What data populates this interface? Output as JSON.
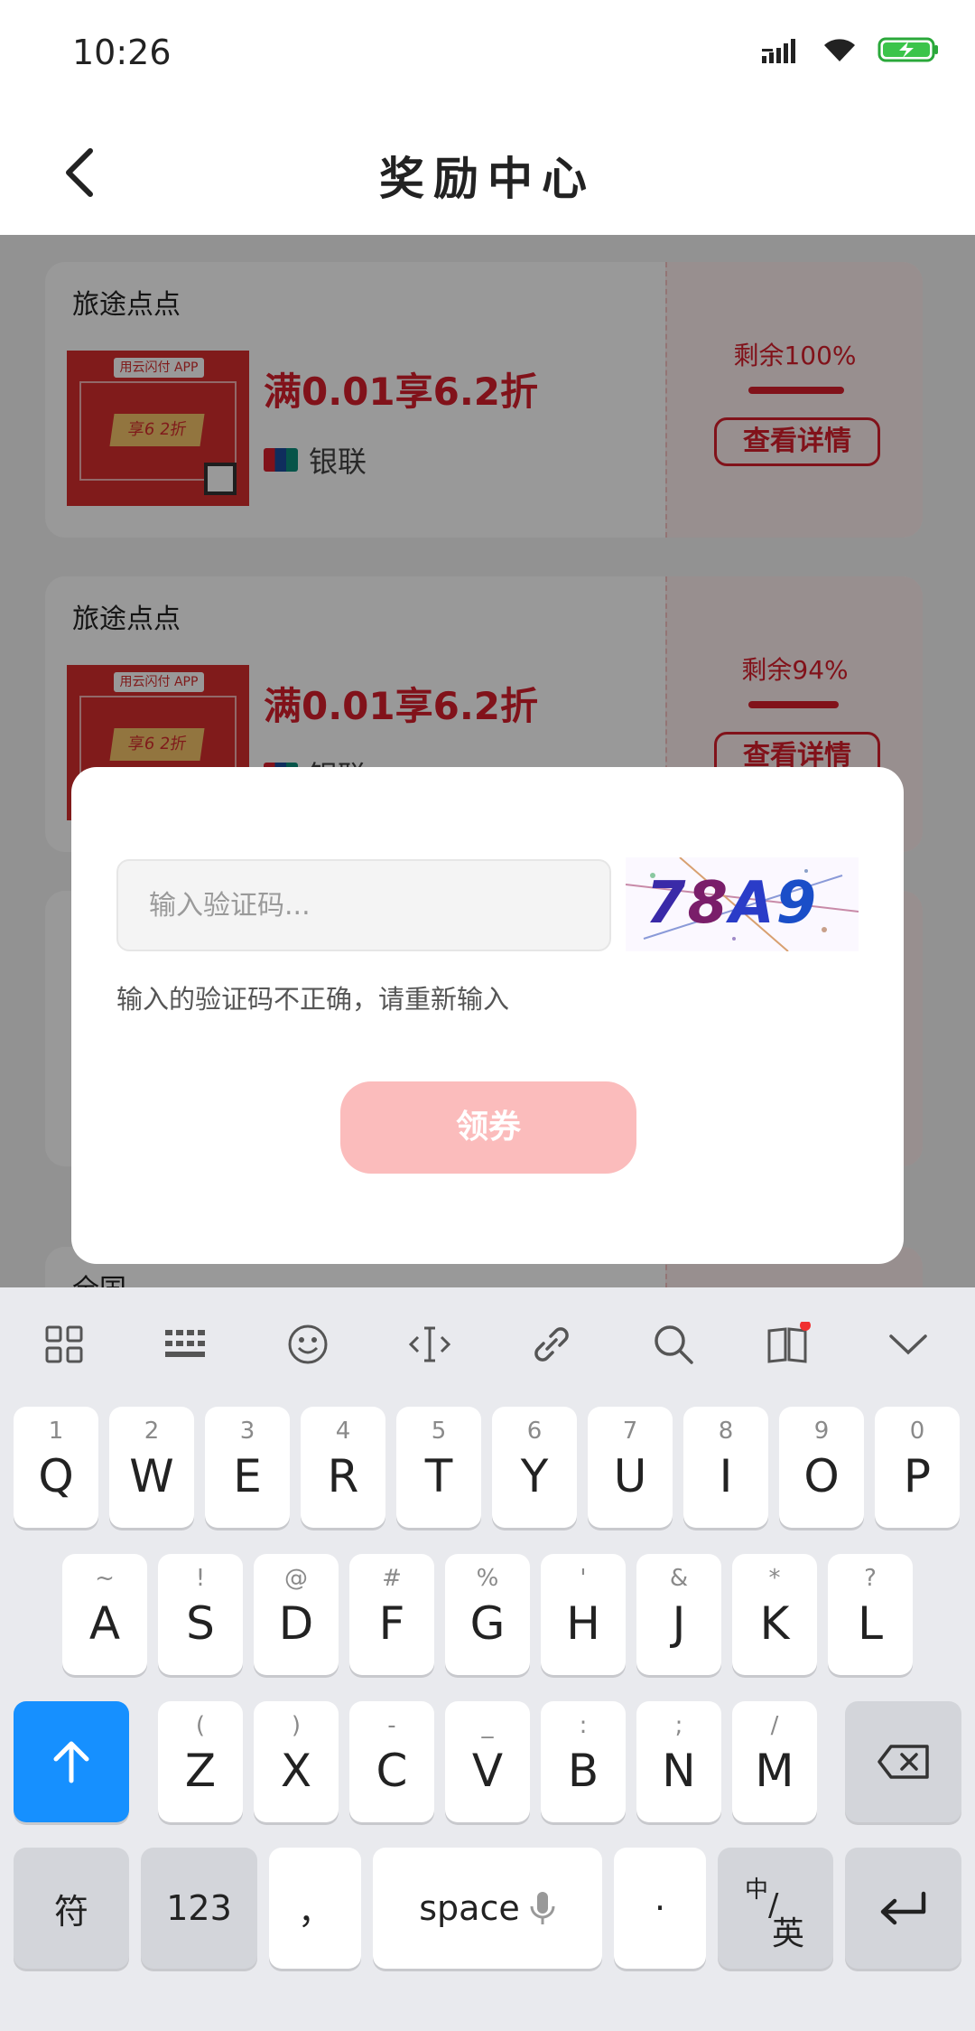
{
  "status_bar": {
    "time": "10:26"
  },
  "header": {
    "title": "奖励中心"
  },
  "coupons": [
    {
      "merchant": "旅途点点",
      "offer": "满0.01享6.2折",
      "bank": "银联",
      "remaining": "剩余100%",
      "remaining_fraction": 1.0,
      "detail_label": "查看详情",
      "img_tag": "用云闪付 APP",
      "img_ribbon": "享6 2折"
    },
    {
      "merchant": "旅途点点",
      "offer": "满0.01享6.2折",
      "bank": "银联",
      "remaining": "剩余94%",
      "remaining_fraction": 0.94,
      "detail_label": "查看详情",
      "img_tag": "用云闪付 APP",
      "img_ribbon": "享6 2折"
    }
  ],
  "partial_merchant": "全国",
  "dialog": {
    "input_placeholder": "输入验证码...",
    "input_value": "",
    "captcha_text": "78A9",
    "error_message": "输入的验证码不正确，请重新输入",
    "claim_button": "领券"
  },
  "keyboard": {
    "row1": [
      {
        "main": "Q",
        "sub": "1"
      },
      {
        "main": "W",
        "sub": "2"
      },
      {
        "main": "E",
        "sub": "3"
      },
      {
        "main": "R",
        "sub": "4"
      },
      {
        "main": "T",
        "sub": "5"
      },
      {
        "main": "Y",
        "sub": "6"
      },
      {
        "main": "U",
        "sub": "7"
      },
      {
        "main": "I",
        "sub": "8"
      },
      {
        "main": "O",
        "sub": "9"
      },
      {
        "main": "P",
        "sub": "0"
      }
    ],
    "row2": [
      {
        "main": "A",
        "sub": "~"
      },
      {
        "main": "S",
        "sub": "!"
      },
      {
        "main": "D",
        "sub": "@"
      },
      {
        "main": "F",
        "sub": "#"
      },
      {
        "main": "G",
        "sub": "%"
      },
      {
        "main": "H",
        "sub": "'"
      },
      {
        "main": "J",
        "sub": "&"
      },
      {
        "main": "K",
        "sub": "*"
      },
      {
        "main": "L",
        "sub": "?"
      }
    ],
    "row3": [
      {
        "main": "Z",
        "sub": "("
      },
      {
        "main": "X",
        "sub": ")"
      },
      {
        "main": "C",
        "sub": "-"
      },
      {
        "main": "V",
        "sub": "_"
      },
      {
        "main": "B",
        "sub": ":"
      },
      {
        "main": "N",
        "sub": ";"
      },
      {
        "main": "M",
        "sub": "/"
      }
    ],
    "symbols_key": "符",
    "numbers_key": "123",
    "comma_key": "，",
    "space_key": "space",
    "period_key": "·",
    "lang_key_top": "中",
    "lang_key_bottom": "英",
    "toolbar_icons": [
      "apps-grid-icon",
      "keyboard-layout-icon",
      "emoji-icon",
      "cursor-icon",
      "clipboard-link-icon",
      "search-icon",
      "dictionary-icon",
      "collapse-keyboard-icon"
    ]
  },
  "colors": {
    "accent_red": "#d81e2c",
    "button_pink": "#fbbcbc",
    "key_blue": "#1690ff"
  }
}
